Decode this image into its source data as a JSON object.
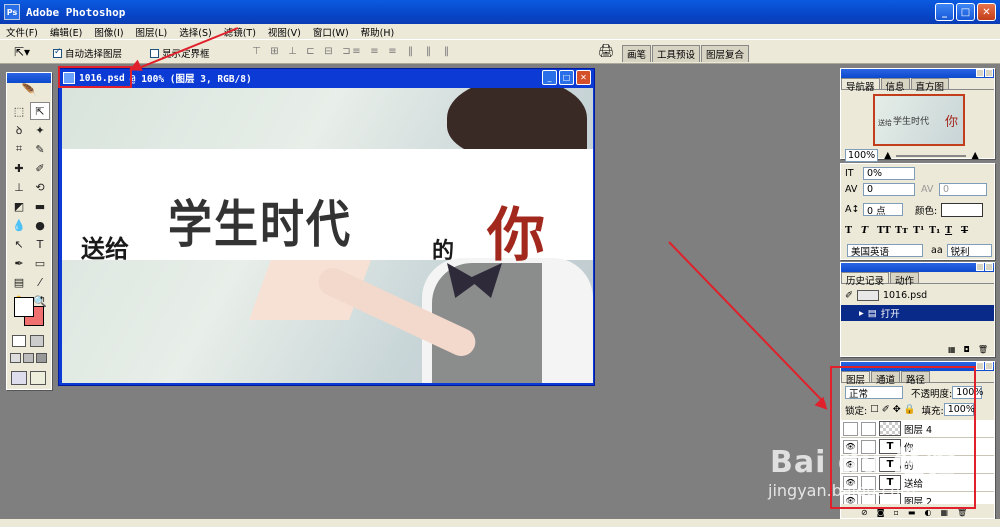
{
  "app": {
    "title": "Adobe Photoshop",
    "logo": "Ps"
  },
  "menu": [
    "文件(F)",
    "编辑(E)",
    "图像(I)",
    "图层(L)",
    "选择(S)",
    "滤镜(T)",
    "视图(V)",
    "窗口(W)",
    "帮助(H)"
  ],
  "options": {
    "auto_select": "自动选择图层",
    "show_bounds": "显示定界框",
    "panel_tabs": [
      "画笔",
      "工具预设",
      "图层复合"
    ]
  },
  "document": {
    "filename": "1016.psd",
    "info": "@ 100% (图层 3, RGB/8)"
  },
  "artwork": {
    "text1": "送给",
    "text2": "学生时代",
    "text3": "的",
    "text4": "你"
  },
  "navigator": {
    "tabs": [
      "导航器",
      "信息",
      "直方图"
    ],
    "zoom": "100%",
    "thumb_left": "送给",
    "thumb_mid": "学生时代",
    "thumb_right": "你"
  },
  "character": {
    "tracking": "0%",
    "kerning": "0",
    "vscale": "0",
    "baseline": "0 点",
    "color_label": "颜色:",
    "language": "美国英语",
    "aa_label": "aa",
    "antialias": "锐利"
  },
  "history": {
    "tabs": [
      "历史记录",
      "动作"
    ],
    "snapshot": "1016.psd",
    "steps": [
      "打开"
    ]
  },
  "layers": {
    "tabs": [
      "图层",
      "通道",
      "路径"
    ],
    "blend_mode": "正常",
    "opacity_label": "不透明度:",
    "opacity": "100%",
    "lock_label": "锁定:",
    "fill_label": "填充:",
    "fill": "100%",
    "items": [
      {
        "name": "图层 4",
        "thumb": ""
      },
      {
        "name": "你",
        "thumb": "T"
      },
      {
        "name": "的",
        "thumb": "T"
      },
      {
        "name": "送给",
        "thumb": "T"
      },
      {
        "name": "图层 2",
        "thumb": ""
      }
    ]
  },
  "watermark": {
    "brand": "Bai du 经验",
    "url": "jingyan.baidu.com"
  },
  "colors": {
    "accent_red": "#e0202a",
    "title_blue": "#0845c8",
    "text_red": "#a2271c"
  }
}
